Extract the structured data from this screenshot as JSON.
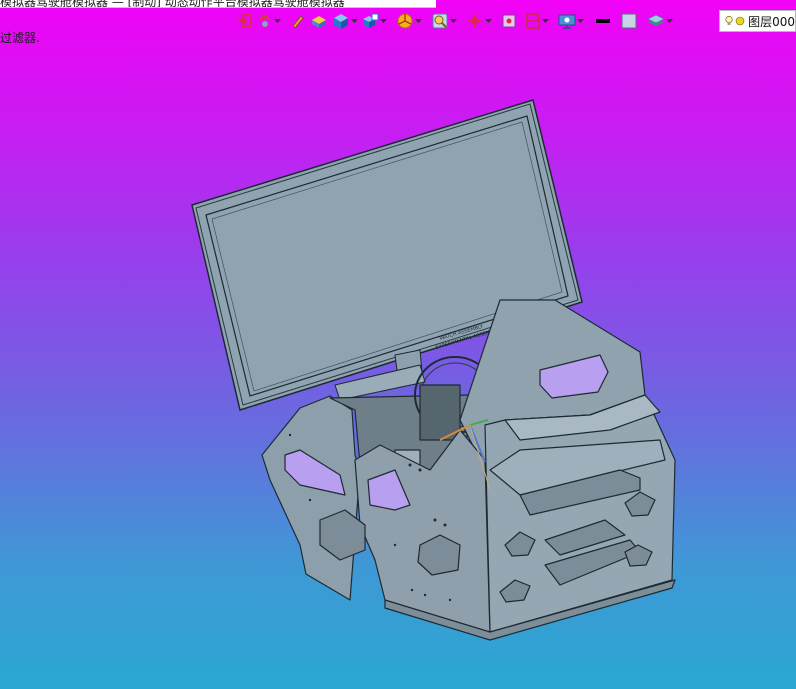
{
  "window": {
    "title": "模拟器驾驶舱模拟器 — [制动] 动态动作平台模拟器驾驶舱模拟器"
  },
  "status": {
    "filter_message": "过滤器."
  },
  "toolbar": {
    "buttons": [
      {
        "name": "exit-sketch-icon",
        "dropdown": false
      },
      {
        "name": "axis-tool-icon",
        "dropdown": true
      },
      {
        "name": "pencil-icon",
        "dropdown": false
      },
      {
        "name": "appearance-icon",
        "dropdown": false
      },
      {
        "name": "display-style-icon",
        "dropdown": true
      },
      {
        "name": "view-orientation-icon",
        "dropdown": true
      },
      {
        "name": "render-tools-icon",
        "dropdown": true
      },
      {
        "name": "zoom-icon",
        "dropdown": true
      },
      {
        "name": "coordinate-icon",
        "dropdown": true
      },
      {
        "name": "section-view-icon",
        "dropdown": false
      },
      {
        "name": "hide-show-icon",
        "dropdown": true
      },
      {
        "name": "monitor-icon",
        "dropdown": true
      },
      {
        "name": "line-color-icon",
        "dropdown": false
      },
      {
        "name": "fill-color-icon",
        "dropdown": false
      },
      {
        "name": "layer-stack-icon",
        "dropdown": true
      }
    ],
    "colors": {
      "line_color": "#000000",
      "fill_color": "#c8d4e8"
    }
  },
  "layer": {
    "label": "图层000"
  },
  "model": {
    "monitor_label_line1": "WATCH ASSEMBLY",
    "monitor_label_line2": "EXPERIMENTAL ASSEMBLY"
  }
}
